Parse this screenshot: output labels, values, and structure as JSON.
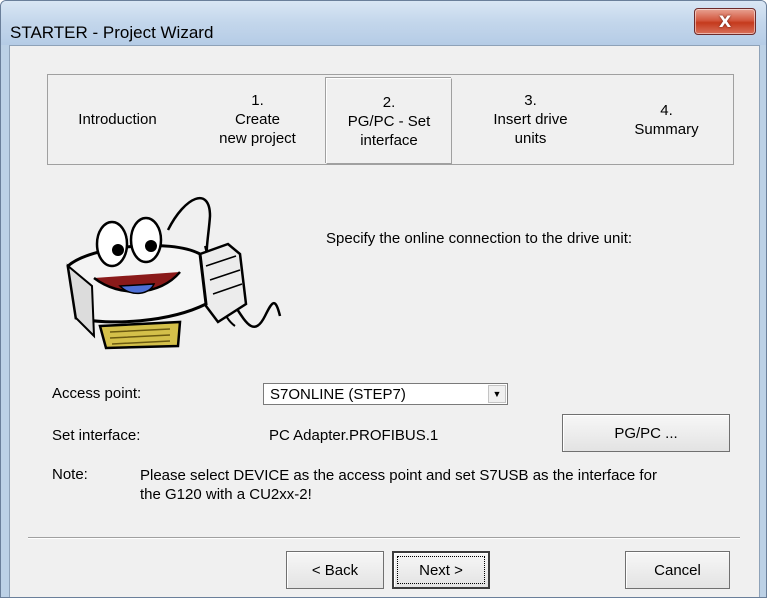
{
  "window": {
    "title": "STARTER - Project Wizard",
    "close_glyph": "X"
  },
  "steps": [
    {
      "number": "",
      "line1": "Introduction",
      "line2": ""
    },
    {
      "number": "1.",
      "line1": "Create",
      "line2": "new project"
    },
    {
      "number": "2.",
      "line1": "PG/PC - Set",
      "line2": "interface"
    },
    {
      "number": "3.",
      "line1": "Insert drive",
      "line2": "units"
    },
    {
      "number": "4.",
      "line1": "Summary",
      "line2": ""
    }
  ],
  "active_step": 2,
  "instruction": "Specify the online connection to the drive unit:",
  "access_point": {
    "label": "Access point:",
    "value": "S7ONLINE (STEP7)"
  },
  "set_interface": {
    "label": "Set interface:",
    "value": "PC Adapter.PROFIBUS.1",
    "button": "PG/PC ..."
  },
  "note": {
    "label": "Note:",
    "text": "Please select DEVICE as the access point and set S7USB as the interface for the G120 with a CU2xx-2!"
  },
  "buttons": {
    "back": "< Back",
    "next": "Next >",
    "cancel": "Cancel"
  },
  "colors": {
    "titlebar": "#c3d6eb",
    "dialog_bg": "#f0f0f0",
    "close_button": "#c53a1d"
  },
  "icons": {
    "mascot": "serial-connector-mascot-illustration",
    "dropdown": "chevron-down-icon",
    "close": "close-icon"
  }
}
